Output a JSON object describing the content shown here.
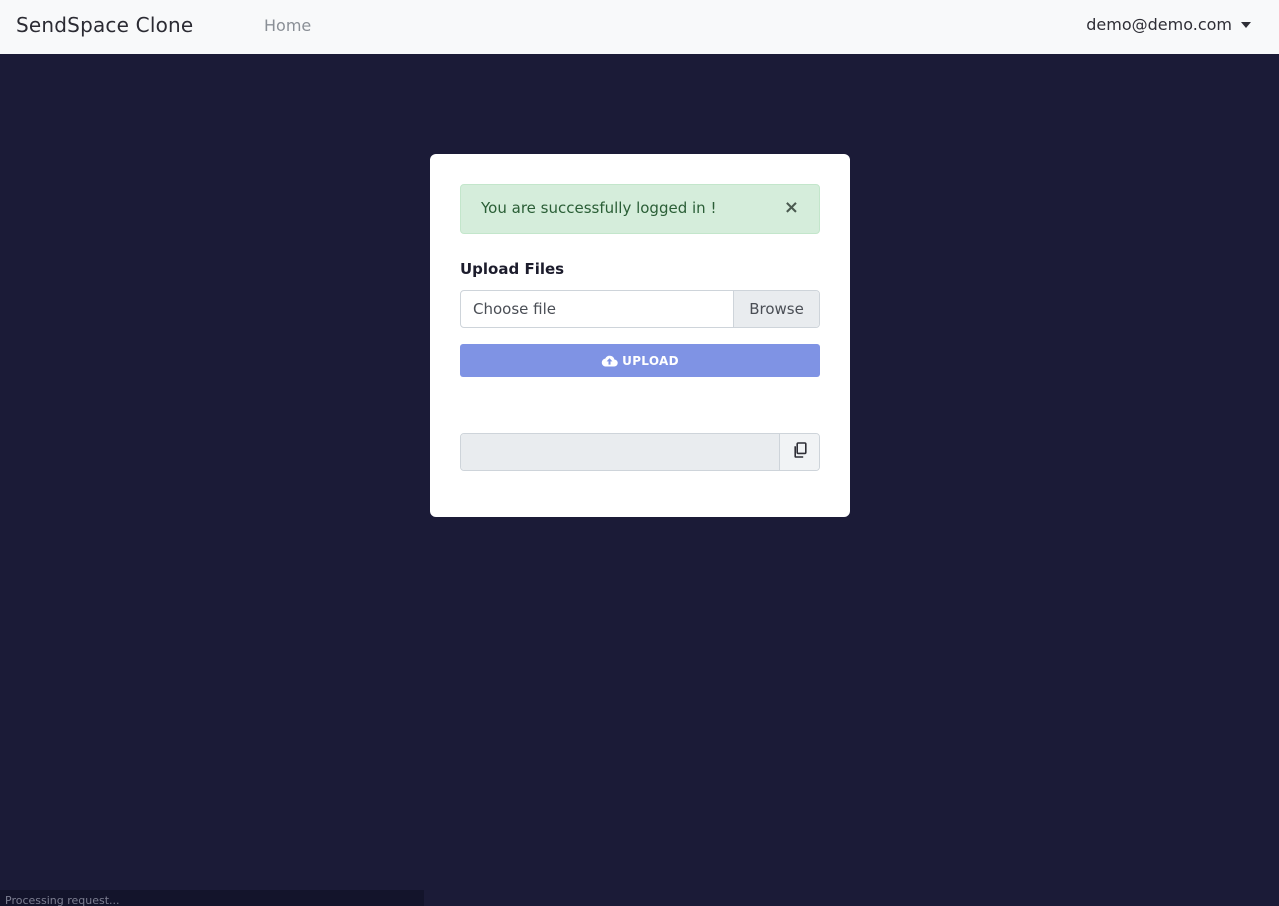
{
  "navbar": {
    "brand": "SendSpace Clone",
    "home_label": "Home",
    "user_email": "demo@demo.com"
  },
  "alert": {
    "message": "You are successfully logged in !",
    "close_symbol": "×"
  },
  "upload": {
    "section_label": "Upload Files",
    "file_placeholder": "Choose file",
    "browse_label": "Browse",
    "button_label": "UPLOAD",
    "button_icon": "cloud-upload-icon"
  },
  "share_link": {
    "value": "",
    "copy_icon": "copy-icon"
  },
  "status_bar": {
    "text": "Processing request..."
  },
  "colors": {
    "page_background": "#1b1b37",
    "navbar_background": "#f8f9fa",
    "alert_background": "#d5eddb",
    "alert_text": "#2a5e36",
    "upload_button": "#7f93e4"
  }
}
